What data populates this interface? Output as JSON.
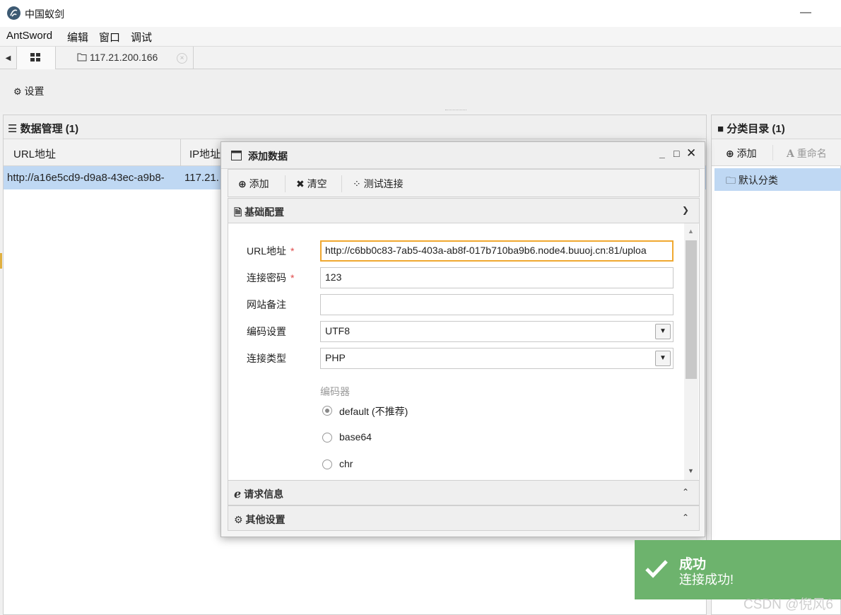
{
  "window": {
    "title": "中国蚁剑",
    "minimize": "—"
  },
  "menu": [
    "AntSword",
    "编辑",
    "窗口",
    "调试"
  ],
  "tabs": {
    "arrow": "◀",
    "host_label": "117.21.200.166",
    "close": "×"
  },
  "toolbar": {
    "settings_label": "设置"
  },
  "data_panel": {
    "title": "数据管理 (1)",
    "columns": [
      "URL地址",
      "IP地址"
    ],
    "rows": [
      {
        "url": "http://a16e5cd9-d9a8-43ec-a9b8-",
        "ip": "117.21."
      }
    ]
  },
  "category_panel": {
    "title": "分类目录 (1)",
    "add_label": "添加",
    "rename_label": "重命名",
    "items": [
      "默认分类"
    ]
  },
  "dialog": {
    "title": "添加数据",
    "toolbar": {
      "add": "添加",
      "clear": "清空",
      "test": "测试连接"
    },
    "sections": {
      "basic": "基础配置",
      "request": "请求信息",
      "other": "其他设置"
    },
    "fields": {
      "url_label": "URL地址",
      "url_value": "http://c6bb0c83-7ab5-403a-ab8f-017b710ba9b6.node4.buuoj.cn:81/uploa",
      "password_label": "连接密码",
      "password_value": "123",
      "note_label": "网站备注",
      "note_value": "",
      "encoding_label": "编码设置",
      "encoding_value": "UTF8",
      "type_label": "连接类型",
      "type_value": "PHP",
      "required_mark": "*"
    },
    "encoder": {
      "label": "编码器",
      "options": [
        "default (不推荐)",
        "base64",
        "chr"
      ],
      "selected": "default (不推荐)"
    }
  },
  "toast": {
    "title": "成功",
    "message": "连接成功!",
    "color": "#6db36d"
  },
  "watermark": "CSDN @倪风6",
  "colors": {
    "selection": "#bfd8f3",
    "required": "#e04a4a",
    "focus_border": "#f0a830"
  }
}
